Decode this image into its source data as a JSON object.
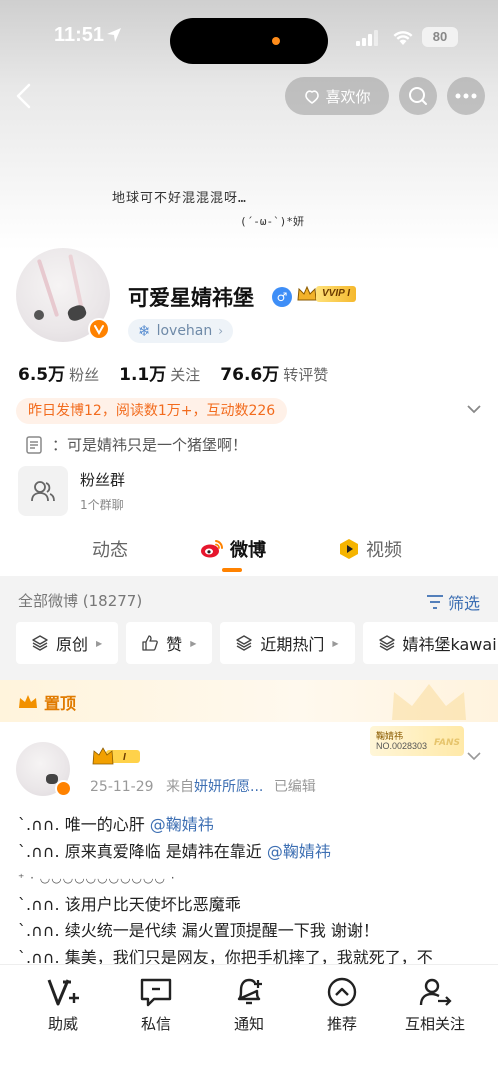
{
  "status": {
    "time": "11:51",
    "battery": "80"
  },
  "header": {
    "like_label": "喜欢你"
  },
  "cover": {
    "line1": "地球可不好混混混呀…",
    "line2": "(´-ω-`)*妍"
  },
  "profile": {
    "name": "可爱星婧祎堡",
    "vip_label": "VVIP I",
    "handle": "lovehan",
    "stats": [
      {
        "num": "6.5万",
        "label": "粉丝"
      },
      {
        "num": "1.1万",
        "label": "关注"
      },
      {
        "num": "76.6万",
        "label": "转评赞"
      }
    ],
    "activity": "昨日发博12，阅读数1万+，互动数226",
    "bio": "：可是婧祎只是一个猪堡啊！"
  },
  "fans_group": {
    "title": "粉丝群",
    "sub": "1个群聊"
  },
  "tabs": [
    {
      "label": "动态"
    },
    {
      "label": "微博"
    },
    {
      "label": "视频"
    }
  ],
  "feed": {
    "all_label": "全部微博 (18277)",
    "filter_label": "筛选",
    "chips": [
      {
        "label": "原创"
      },
      {
        "label": "赞"
      },
      {
        "label": "近期热门"
      },
      {
        "label": "婧祎堡kawai"
      }
    ],
    "pinned_label": "置顶"
  },
  "post": {
    "date": "25-11-29",
    "source_prefix": "来自",
    "source": "妍妍所愿...",
    "edited": "已编辑",
    "fans_card": {
      "name": "鞠婧祎",
      "no": "NO.0028303",
      "tag": "FANS"
    },
    "lines": [
      {
        "prefix": "ˋ.∩∩.",
        "text": "唯一的心肝",
        "mention": "@鞠婧祎"
      },
      {
        "prefix": "ˋ.∩∩.",
        "text": "原来真爱降临 是婧祎在靠近",
        "mention": "@鞠婧祎"
      },
      {
        "prefix": "",
        "text": "  ⁺  ·  ◡◡◡◡◡◡◡◡◡◡◡       ·",
        "mention": ""
      },
      {
        "prefix": "ˋ.∩∩.",
        "text": "该用户比天使坏比恶魔乖",
        "mention": ""
      },
      {
        "prefix": "ˋ.∩∩.",
        "text": "续火统一是代续 漏火置顶提醒一下我 谢谢！",
        "mention": ""
      },
      {
        "prefix": "ˋ.∩∩.",
        "text": "集美，我们只是网友，你把手机摔了，我就死了，不",
        "mention": ""
      }
    ]
  },
  "bottom_nav": [
    {
      "label": "助威",
      "icon": "v-plus-icon"
    },
    {
      "label": "私信",
      "icon": "chat-icon"
    },
    {
      "label": "通知",
      "icon": "bell-icon"
    },
    {
      "label": "推荐",
      "icon": "up-circle-icon"
    },
    {
      "label": "互相关注",
      "icon": "user-check-icon"
    }
  ]
}
